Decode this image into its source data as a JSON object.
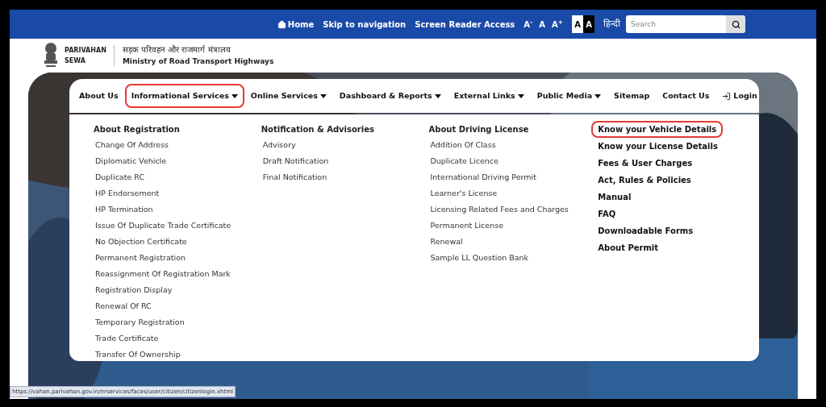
{
  "top_bar": {
    "links": [
      {
        "kind": "home",
        "label": "Home"
      },
      {
        "kind": "text",
        "label": "Skip to navigation"
      },
      {
        "kind": "text",
        "label": "Screen Reader Access"
      }
    ],
    "font_sizes": [
      "A$^{-}$",
      "A",
      "A$^{+}$"
    ],
    "contrast": [
      {
        "label": "A",
        "kind": "light"
      },
      {
        "label": "A",
        "kind": "dark"
      }
    ],
    "language": "हिन्दी",
    "search": {
      "placeholder": "Search"
    }
  },
  "header": {
    "org_name": [
      "PARIVAHAN",
      "SEWA"
    ],
    "ministry_hindi": "सड़क परिवहन और राजमार्ग मंत्रालय",
    "ministry_english": "Ministry of Road Transport Highways"
  },
  "nav": [
    {
      "label": "About Us",
      "caret": false,
      "highlighted": false,
      "kind": "link"
    },
    {
      "label": "Informational Services",
      "caret": true,
      "highlighted": true,
      "kind": "link"
    },
    {
      "label": "Online Services",
      "caret": true,
      "highlighted": false,
      "kind": "link"
    },
    {
      "label": "Dashboard & Reports",
      "caret": true,
      "highlighted": false,
      "kind": "link"
    },
    {
      "label": "External Links",
      "caret": true,
      "highlighted": false,
      "kind": "link"
    },
    {
      "label": "Public Media",
      "caret": true,
      "highlighted": false,
      "kind": "link"
    },
    {
      "label": "Sitemap",
      "caret": false,
      "highlighted": false,
      "kind": "link"
    },
    {
      "label": "Contact Us",
      "caret": false,
      "highlighted": false,
      "kind": "link"
    },
    {
      "label": "Login",
      "caret": false,
      "highlighted": false,
      "kind": "login"
    }
  ],
  "menu_columns": [
    {
      "kind": "group",
      "heading": "About Registration",
      "items": [
        {
          "label": "Change Of Address",
          "highlighted": false
        },
        {
          "label": "Diplomatic Vehicle",
          "highlighted": false
        },
        {
          "label": "Duplicate RC",
          "highlighted": false
        },
        {
          "label": "HP Endorsement",
          "highlighted": false
        },
        {
          "label": "HP Termination",
          "highlighted": false
        },
        {
          "label": "Issue Of Duplicate Trade Certificate",
          "highlighted": false
        },
        {
          "label": "No Objection Certificate",
          "highlighted": false
        },
        {
          "label": "Permanent Registration",
          "highlighted": false
        },
        {
          "label": "Reassignment Of Registration Mark",
          "highlighted": false
        },
        {
          "label": "Registration Display",
          "highlighted": false
        },
        {
          "label": "Renewal Of RC",
          "highlighted": false
        },
        {
          "label": "Temporary Registration",
          "highlighted": false
        },
        {
          "label": "Trade Certificate",
          "highlighted": false
        },
        {
          "label": "Transfer Of Ownership",
          "highlighted": false
        }
      ]
    },
    {
      "kind": "group",
      "heading": "Notification & Advisories",
      "items": [
        {
          "label": "Advisory",
          "highlighted": false
        },
        {
          "label": "Draft Notification",
          "highlighted": false
        },
        {
          "label": "Final Notification",
          "highlighted": false
        }
      ]
    },
    {
      "kind": "group",
      "heading": "About Driving License",
      "items": [
        {
          "label": "Addition Of Class",
          "highlighted": false
        },
        {
          "label": "Duplicate Licence",
          "highlighted": false
        },
        {
          "label": "International Driving Permit",
          "highlighted": false
        },
        {
          "label": "Learner's License",
          "highlighted": false
        },
        {
          "label": "Licensing Related Fees and Charges",
          "highlighted": false
        },
        {
          "label": "Permanent License",
          "highlighted": false
        },
        {
          "label": "Renewal",
          "highlighted": false
        },
        {
          "label": "Sample LL Question Bank",
          "highlighted": false
        }
      ]
    },
    {
      "kind": "quick_links",
      "items": [
        {
          "label": "Know your Vehicle Details",
          "highlighted": true
        },
        {
          "label": "Know your License Details",
          "highlighted": false
        },
        {
          "label": "Fees & User Charges",
          "highlighted": false
        },
        {
          "label": "Act, Rules & Policies",
          "highlighted": false
        },
        {
          "label": "Manual",
          "highlighted": false
        },
        {
          "label": "FAQ",
          "highlighted": false
        },
        {
          "label": "Downloadable Forms",
          "highlighted": false
        },
        {
          "label": "About Permit",
          "highlighted": false
        }
      ]
    }
  ],
  "status_url": "https://vahan.parivahan.gov.in/nrservices/faces/user/citizen/citizenlogin.xhtml"
}
